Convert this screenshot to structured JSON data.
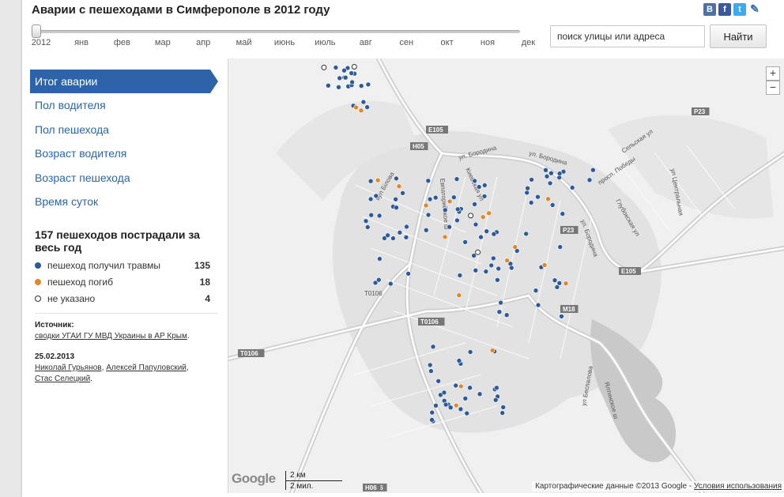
{
  "title": "Аварии с пешеходами в Симферополе в 2012 году",
  "social": [
    {
      "name": "vk-icon",
      "glyph": "B"
    },
    {
      "name": "facebook-icon",
      "glyph": "f"
    },
    {
      "name": "twitter-icon",
      "glyph": "t"
    },
    {
      "name": "edit-icon",
      "glyph": "✎"
    }
  ],
  "timeline": {
    "year": "2012",
    "months": [
      "янв",
      "фев",
      "мар",
      "апр",
      "май",
      "июнь",
      "июль",
      "авг",
      "сен",
      "окт",
      "ноя",
      "дек"
    ],
    "position": 0
  },
  "search": {
    "placeholder": "поиск улицы или адреса",
    "button": "Найти"
  },
  "menu": [
    {
      "label": "Итог аварии",
      "active": true
    },
    {
      "label": "Пол водителя",
      "active": false
    },
    {
      "label": "Пол пешехода",
      "active": false
    },
    {
      "label": "Возраст водителя",
      "active": false
    },
    {
      "label": "Возраст пешехода",
      "active": false
    },
    {
      "label": "Время суток",
      "active": false
    }
  ],
  "stats": {
    "title": "157 пешеходов пострадали за весь год",
    "legend": [
      {
        "label": "пешеход получил травмы",
        "count": "135",
        "color": "#2d5b9a"
      },
      {
        "label": "пешеход погиб",
        "count": "18",
        "color": "#e0872d"
      },
      {
        "label": "не указано",
        "count": "4",
        "color": "#ffffff"
      }
    ]
  },
  "source": {
    "heading": "Источник:",
    "link": "сводки УГАИ ГУ МВД Украины в АР Крым",
    "link_suffix": ".",
    "date": "25.02.2013",
    "authors": [
      "Николай Гурьянов",
      "Алексей Папуловский",
      "Стас Селецкий"
    ],
    "author_separators": [
      ", ",
      ",",
      "."
    ]
  },
  "map": {
    "zoom_in": "+",
    "zoom_out": "−",
    "logo": "Google",
    "scale_km": "2 км",
    "scale_mi": "2 мил.",
    "attribution": "Картографические данные ©2013 Google - ",
    "terms": "Условия использования",
    "road_shields": [
      "E105",
      "H05",
      "P23",
      "M18",
      "E105",
      "T0106",
      "T0106",
      "H06",
      "P23",
      "H06"
    ],
    "street_labels": [
      "ул. Бородина",
      "ул. Бородина",
      "Киевская ул",
      "Евпаторийское ш",
      "вул Білова",
      "просп. Победы",
      "Сельская ул",
      "ул Центральная",
      "Глубокская ул",
      "ул. Бородина",
      "ул Беспалова",
      "Ялтинское ш",
      "Т0106"
    ],
    "incident_counts": {
      "injured": 135,
      "killed": 18,
      "unspecified": 4
    }
  }
}
